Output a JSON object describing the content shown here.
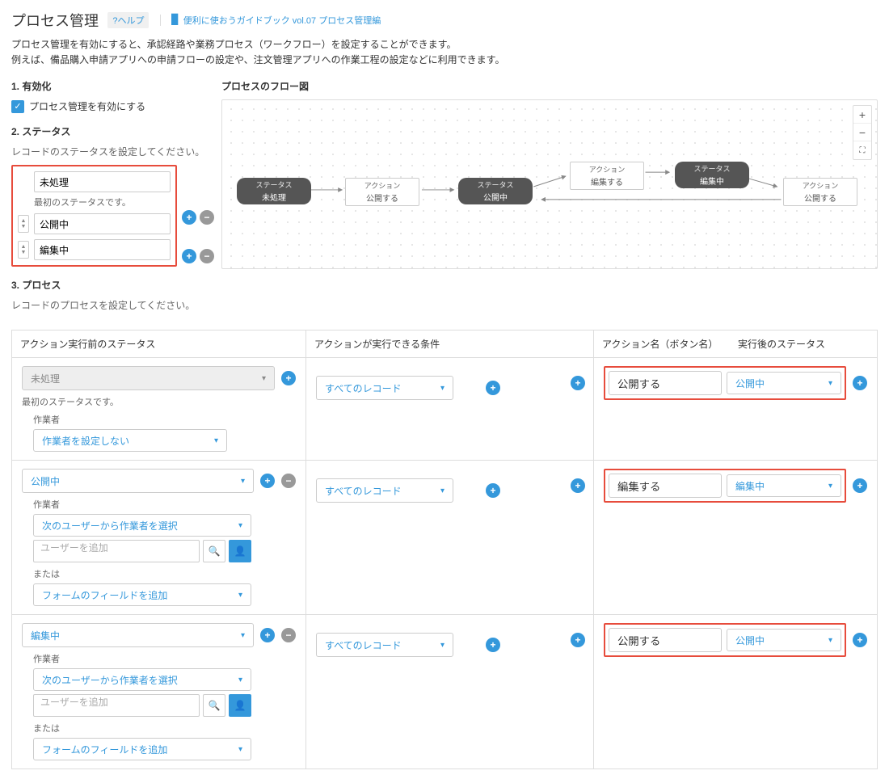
{
  "header": {
    "title": "プロセス管理",
    "help": "?ヘルプ",
    "guide_prefix": "便利に使おうガイドブック vol.07 プロセス管理編"
  },
  "description": {
    "line1": "プロセス管理を有効にすると、承認経路や業務プロセス（ワークフロー）を設定することができます。",
    "line2": "例えば、備品購入申請アプリへの申請フローの設定や、注文管理アプリへの作業工程の設定などに利用できます。"
  },
  "enable": {
    "heading": "1. 有効化",
    "checkbox_label": "プロセス管理を有効にする",
    "checked": true
  },
  "status": {
    "heading": "2. ステータス",
    "desc": "レコードのステータスを設定してください。",
    "initial_note": "最初のステータスです。",
    "items": [
      {
        "value": "未処理",
        "initial": true
      },
      {
        "value": "公開中"
      },
      {
        "value": "編集中"
      }
    ]
  },
  "flow": {
    "heading": "プロセスのフロー図",
    "labels": {
      "status": "ステータス",
      "action": "アクション"
    },
    "nodes": {
      "s1": "未処理",
      "a1": "公開する",
      "s2": "公開中",
      "a2": "編集する",
      "s3": "編集中",
      "a3": "公開する"
    }
  },
  "process": {
    "heading": "3. プロセス",
    "desc": "レコードのプロセスを設定してください。",
    "columns": {
      "before": "アクション実行前のステータス",
      "cond": "アクションが実行できる条件",
      "action": "アクション名（ボタン名）",
      "after": "実行後のステータス"
    },
    "common": {
      "all_records": "すべてのレコード",
      "assignee_label": "作業者",
      "no_assignee": "作業者を設定しない",
      "select_assignee": "次のユーザーから作業者を選択",
      "add_user_ph": "ユーザーを追加",
      "or_label": "または",
      "add_form_field": "フォームのフィールドを追加",
      "initial_note": "最初のステータスです。"
    },
    "rows": [
      {
        "before": "未処理",
        "before_muted": true,
        "action": "公開する",
        "after": "公開中",
        "assignee_mode": "none"
      },
      {
        "before": "公開中",
        "action": "編集する",
        "after": "編集中",
        "assignee_mode": "select"
      },
      {
        "before": "編集中",
        "action": "公開する",
        "after": "公開中",
        "assignee_mode": "select"
      }
    ]
  }
}
